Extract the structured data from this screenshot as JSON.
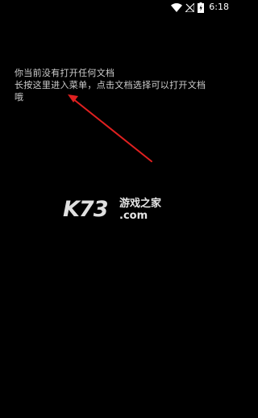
{
  "status_bar": {
    "time": "6:18",
    "icons": [
      "wifi-icon",
      "signal-off-icon",
      "battery-charging-icon"
    ]
  },
  "hint": {
    "line1": "你当前没有打开任何文档",
    "line2": "长按这里进入菜单，点击文档选择可以打开文档",
    "line3": "哦"
  },
  "watermark": {
    "logo": "K73",
    "brand": "游戏之家",
    "domain": ".com"
  },
  "colors": {
    "background": "#000000",
    "text": "#cfcfcf",
    "annotation_arrow": "#e02020"
  }
}
